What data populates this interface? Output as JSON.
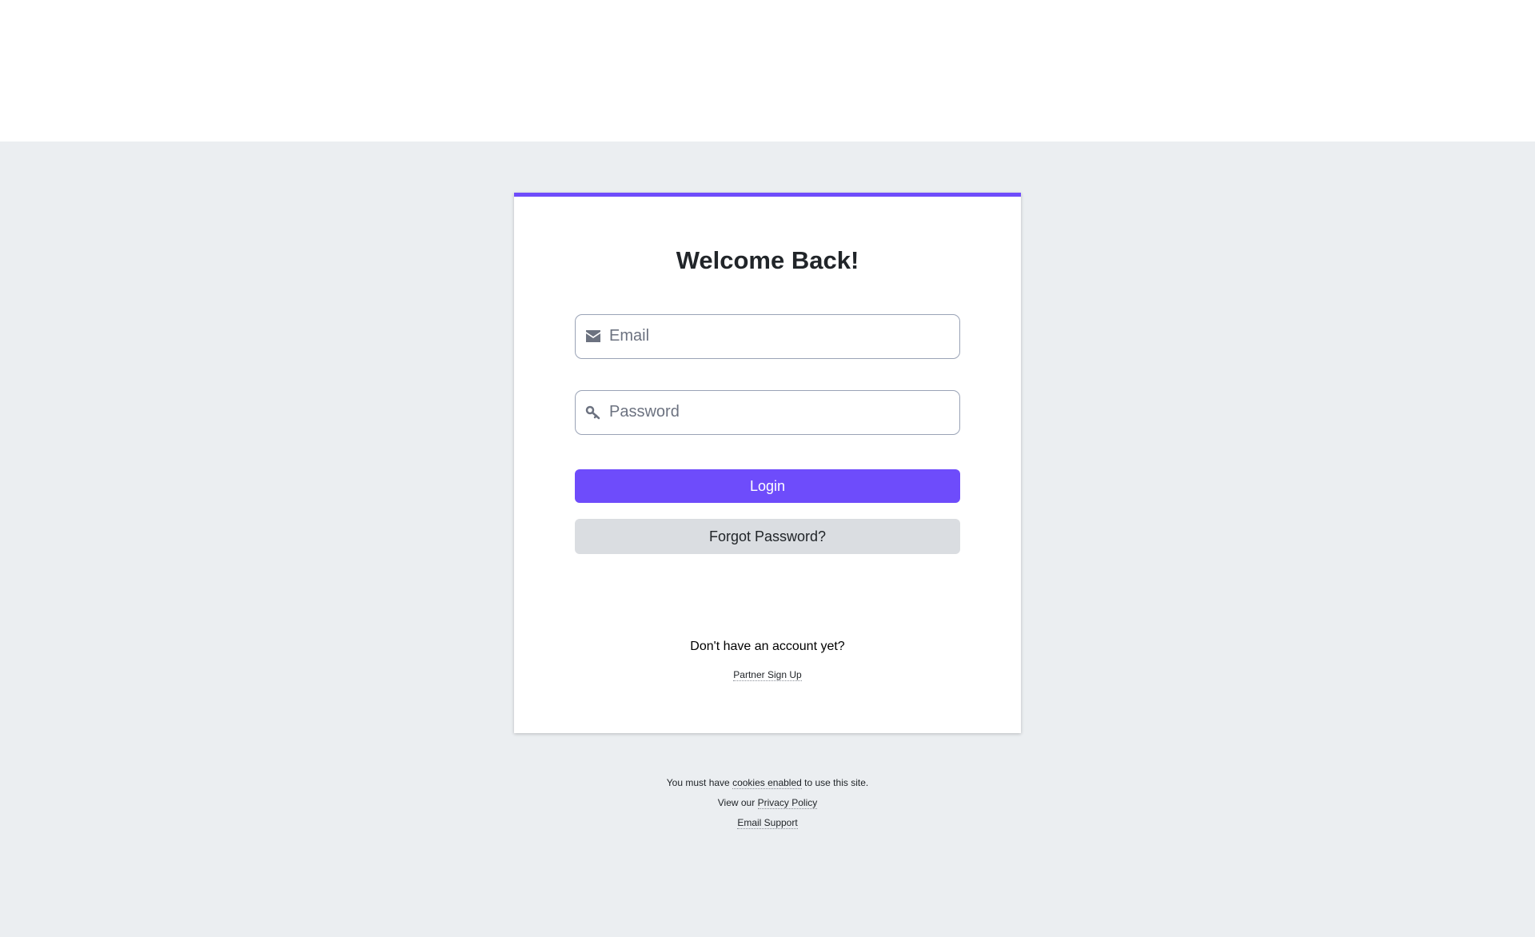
{
  "login": {
    "title": "Welcome Back!",
    "email_placeholder": "Email",
    "password_placeholder": "Password",
    "login_label": "Login",
    "forgot_label": "Forgot Password?",
    "no_account_text": "Don't have an account yet?",
    "signup_link": "Partner Sign Up"
  },
  "footer": {
    "cookies_prefix": "You must have",
    "cookies_link": "cookies enabled",
    "cookies_suffix": "to use this site.",
    "privacy_prefix": "View our",
    "privacy_link": "Privacy Policy",
    "support_link": "Email Support"
  },
  "icons": {
    "email": "envelope-icon",
    "password": "key-icon"
  },
  "colors": {
    "accent": "#6e4cfb",
    "background": "#ebeef1",
    "secondary_button": "#dadde1"
  }
}
